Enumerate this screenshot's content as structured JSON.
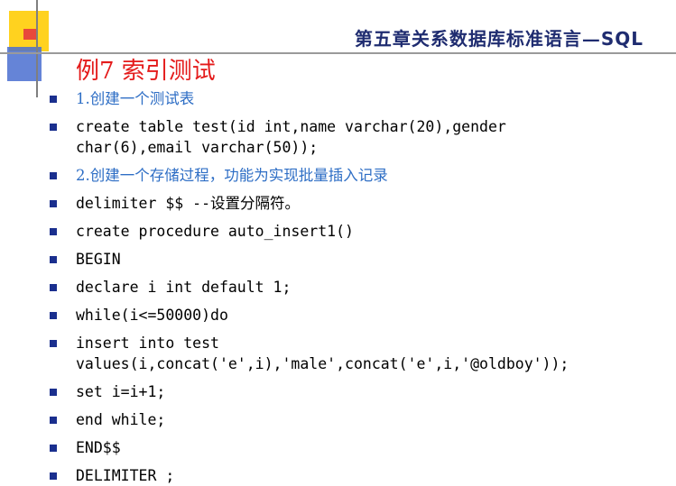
{
  "header": {
    "title_main": "第五章关系数据库标准语言—",
    "title_sql": "SQL"
  },
  "slide": {
    "title": "例7  索引测试"
  },
  "items": [
    {
      "lines": [
        "1.创建一个测试表"
      ],
      "style": "blue-zh"
    },
    {
      "lines": [
        "create table test(id int,name varchar(20),gender",
        "char(6),email varchar(50));"
      ],
      "style": "code"
    },
    {
      "lines": [
        "2.创建一个存储过程，功能为实现批量插入记录"
      ],
      "style": "blue-zh"
    },
    {
      "lines": [
        "delimiter $$ --设置分隔符。"
      ],
      "style": "code"
    },
    {
      "lines": [
        "create procedure auto_insert1()"
      ],
      "style": "code"
    },
    {
      "lines": [
        "BEGIN"
      ],
      "style": "code"
    },
    {
      "lines": [
        "declare i int default 1;"
      ],
      "style": "code"
    },
    {
      "lines": [
        "while(i<=50000)do"
      ],
      "style": "code"
    },
    {
      "lines": [
        "insert into test",
        "values(i,concat('e',i),'male',concat('e',i,'@oldboy'));"
      ],
      "style": "code"
    },
    {
      "lines": [
        "set i=i+1;"
      ],
      "style": "code"
    },
    {
      "lines": [
        "end while;"
      ],
      "style": "code"
    },
    {
      "lines": [
        "END$$"
      ],
      "style": "code"
    },
    {
      "lines": [
        "DELIMITER ;"
      ],
      "style": "code"
    }
  ],
  "colors": {
    "header": "#1f2c70",
    "title": "#e41a1a",
    "accent_blue": "#2e6ec5",
    "bullet": "#1a2f8e",
    "deco_yellow": "#ffd21f",
    "deco_red": "#e8483b",
    "deco_blue": "#4a6fd0"
  }
}
